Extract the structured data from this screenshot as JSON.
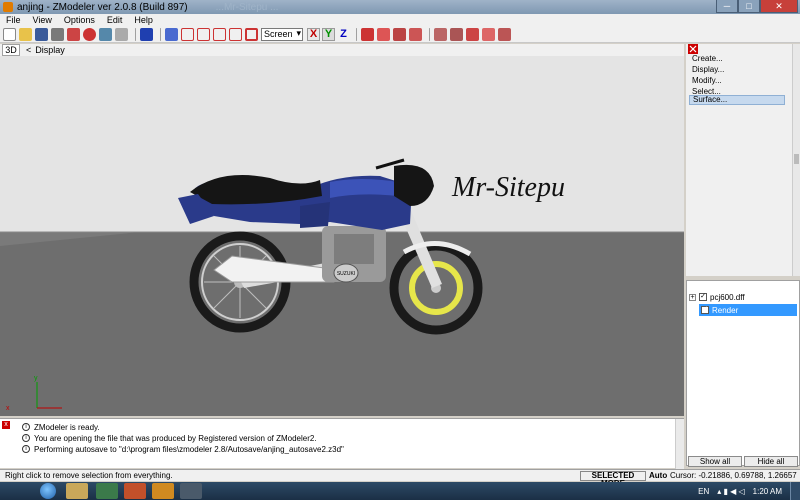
{
  "window": {
    "title": "anjing - ZModeler ver 2.0.8 (Build 897)",
    "ghost_title": "...Mr-Sitepu ...",
    "minimize": "─",
    "maximize": "□",
    "close": "✕"
  },
  "menu": [
    "File",
    "View",
    "Options",
    "Edit",
    "Help"
  ],
  "toolbar": {
    "view_mode": "Screen",
    "axes": [
      "X",
      "Y",
      "Z"
    ]
  },
  "viewport": {
    "tab": "3D",
    "arrow": "<",
    "label": "Display",
    "overlay_text": "Mr-Sitepu",
    "bike_brand": "SUZUKI",
    "axis_x": "x",
    "axis_y": "y"
  },
  "side_menu": {
    "items": [
      "Create...",
      "Display...",
      "Modify...",
      "Select...",
      "Surface..."
    ],
    "active": "Surface..."
  },
  "scene_tree": {
    "items": [
      {
        "label": "pcj600.dff",
        "checked": true,
        "expandable": true
      },
      {
        "label": "Render",
        "checked": true,
        "selected": true
      }
    ],
    "show_all": "Show all",
    "hide_all": "Hide all"
  },
  "log": {
    "lines": [
      "ZModeler is ready.",
      "You are opening the file that was produced by Registered version of ZModeler2.",
      "Performing autosave to \"d:\\program files\\zmodeler 2.8/Autosave/anjing_autosave2.z3d\""
    ]
  },
  "status": {
    "hint": "Right click to remove selection from everything.",
    "mode": "SELECTED MODE",
    "auto": "Auto",
    "cursor": "Cursor: -0.21886, 0.69788, 1.26657"
  },
  "taskbar": {
    "lang": "EN",
    "time": "1:20 AM"
  },
  "colors": {
    "bike_body": "#2a3a8a",
    "ground": "#6e6e6e",
    "sky": "#e4e4e4",
    "selected": "#3399ff"
  }
}
